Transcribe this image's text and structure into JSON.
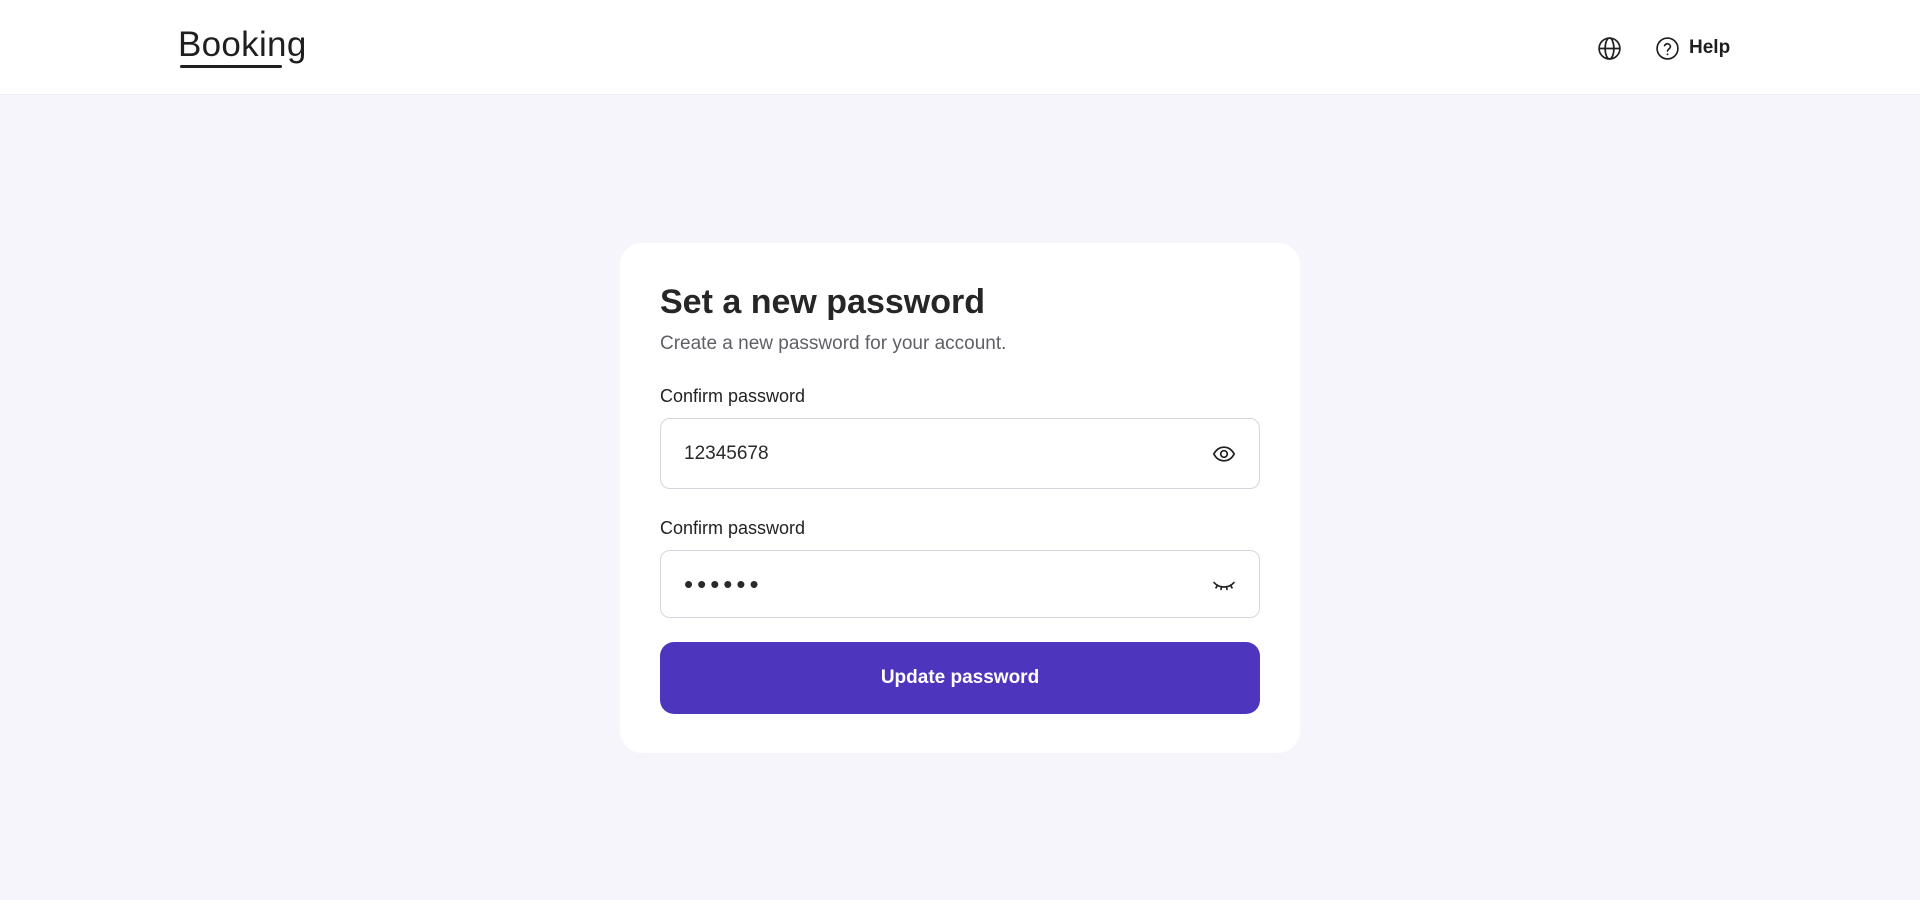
{
  "header": {
    "logo": "Booking",
    "language_icon": "globe-icon",
    "help": {
      "icon": "help-circle-icon",
      "label": "Help"
    }
  },
  "form": {
    "title": "Set a new password",
    "subtitle": "Create a new password for your account.",
    "fields": [
      {
        "label": "Confirm password",
        "value": "12345678",
        "type": "text",
        "toggle_icon": "eye-open-icon"
      },
      {
        "label": "Confirm password",
        "value": "••••••",
        "type": "password",
        "toggle_icon": "eye-closed-icon"
      }
    ],
    "submit_label": "Update password"
  },
  "colors": {
    "background": "#f7f5fc",
    "card": "#ffffff",
    "primary": "#4d35bd",
    "text": "#1f1f1f",
    "muted": "#5f5f66",
    "border": "#d6d4dc"
  }
}
